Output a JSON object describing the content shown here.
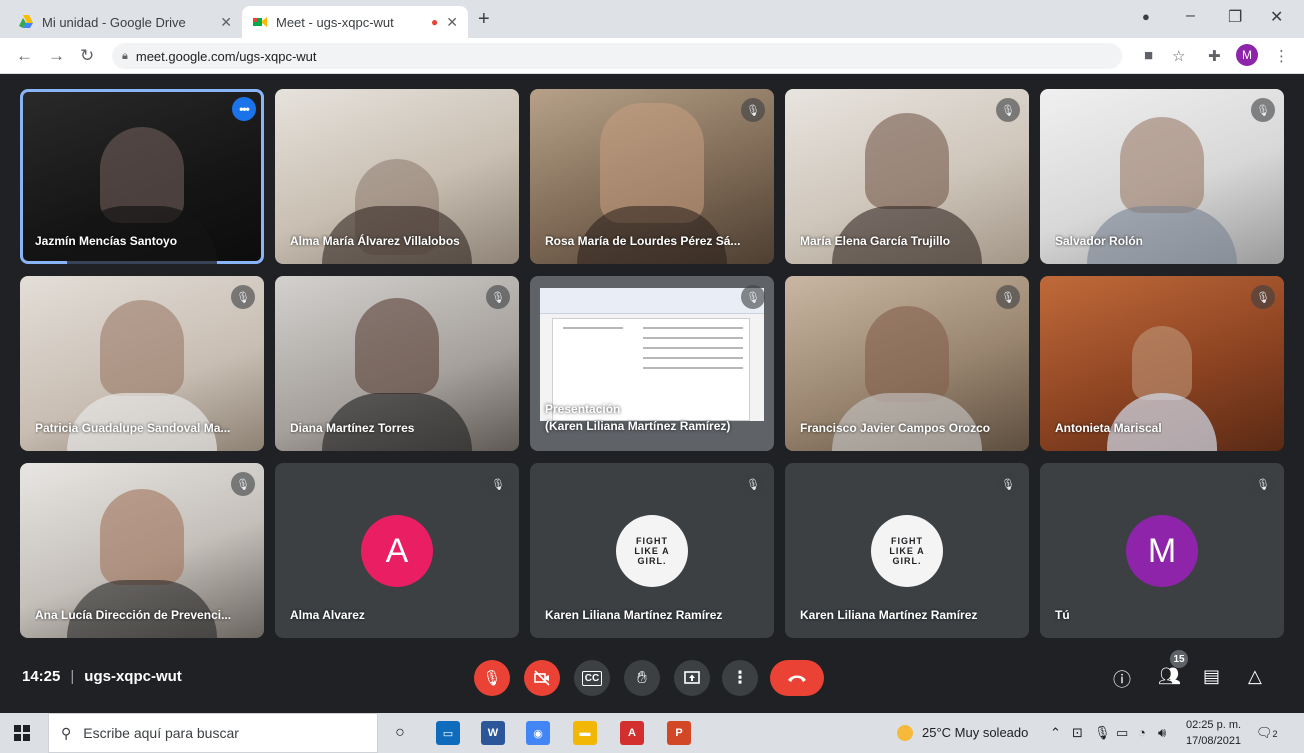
{
  "browser": {
    "tabs": [
      {
        "title": "Mi unidad - Google Drive",
        "icon": "google-drive-icon",
        "active": false
      },
      {
        "title": "Meet - ugs-xqpc-wut",
        "icon": "google-meet-icon",
        "active": true,
        "recording": true
      }
    ],
    "url": "meet.google.com/ugs-xqpc-wut",
    "profile_initial": "M"
  },
  "meet": {
    "participants": [
      {
        "name": "Jazmín Mencías Santoyo",
        "type": "camera",
        "muted": false,
        "highlighted": true
      },
      {
        "name": "Alma María Álvarez Villalobos",
        "type": "camera",
        "muted": false
      },
      {
        "name": "Rosa María de Lourdes Pérez Sá...",
        "type": "camera",
        "muted": true
      },
      {
        "name": "María Elena García Trujillo",
        "type": "camera",
        "muted": true
      },
      {
        "name": "Salvador Rolón",
        "type": "camera",
        "muted": true
      },
      {
        "name": "Patricia Guadalupe Sandoval Ma...",
        "type": "camera",
        "muted": true
      },
      {
        "name": "Diana Martínez Torres",
        "type": "camera",
        "muted": true
      },
      {
        "name": "Presentación\n(Karen Liliana Martínez Ramírez)",
        "type": "presentation",
        "muted": true
      },
      {
        "name": "Francisco Javier Campos Orozco",
        "type": "camera",
        "muted": true
      },
      {
        "name": "Antonieta Mariscal",
        "type": "camera",
        "muted": true
      },
      {
        "name": "Ana Lucía Dirección de Prevenci...",
        "type": "camera",
        "muted": true
      },
      {
        "name": "Alma Alvarez",
        "type": "avatar",
        "initial": "A",
        "color": "#e91e63",
        "muted": true
      },
      {
        "name": "Karen Liliana Martínez Ramírez",
        "type": "logo",
        "logo_text": "FIGHT\nLIKE A\nGIRL.",
        "muted": true
      },
      {
        "name": "Karen Liliana Martínez Ramírez",
        "type": "logo",
        "logo_text": "FIGHT\nLIKE A\nGIRL.",
        "muted": true
      },
      {
        "name": "Tú",
        "type": "avatar",
        "initial": "M",
        "color": "#8e24aa",
        "muted": true
      }
    ],
    "time": "14:25",
    "meeting_code": "ugs-xqpc-wut",
    "participant_count": "15"
  },
  "taskbar": {
    "search_placeholder": "Escribe aquí para buscar",
    "weather": "25°C  Muy soleado",
    "clock_time": "02:25 p. m.",
    "clock_date": "17/08/2021",
    "notifications": "2"
  },
  "colors": {
    "meet_bg": "#202124",
    "tile_bg": "#3c4043",
    "danger_red": "#ea4335",
    "highlight_blue": "#8ab4f8"
  }
}
